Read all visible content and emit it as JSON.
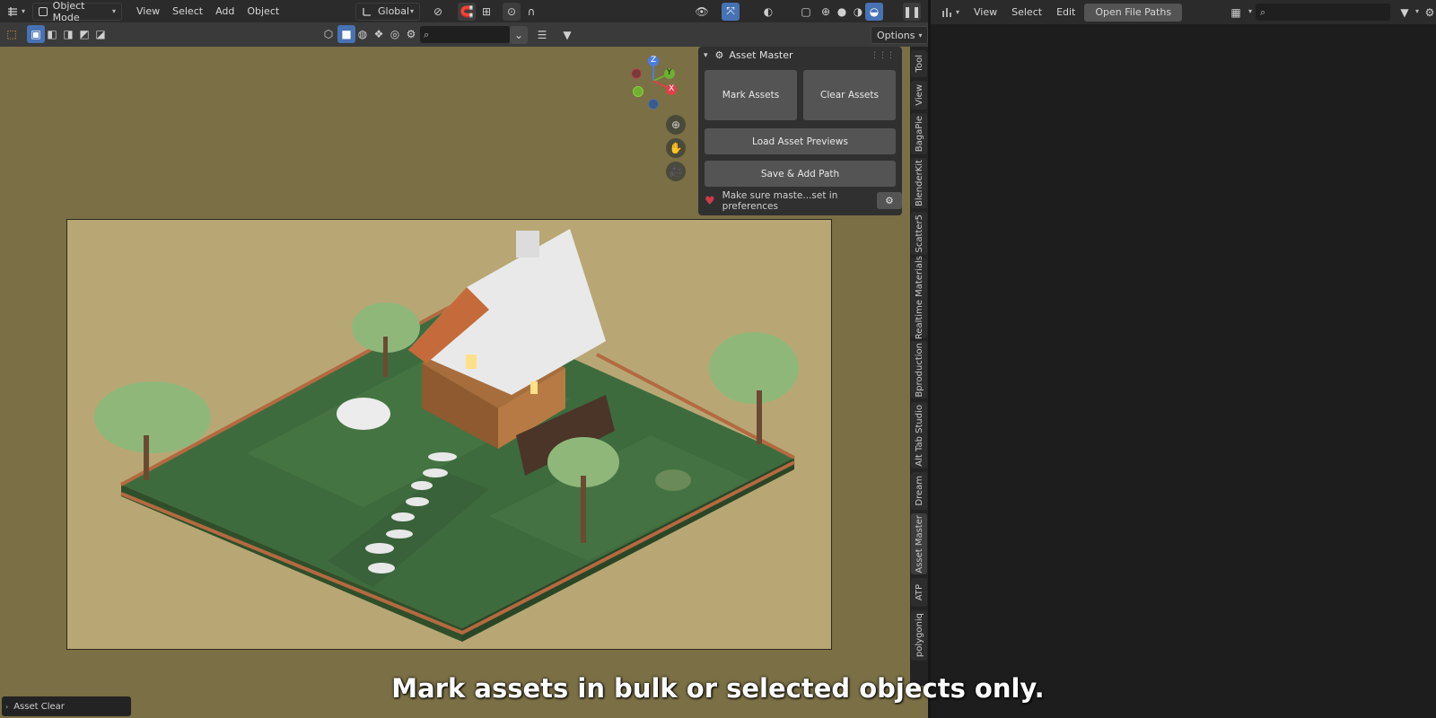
{
  "viewport_header": {
    "mode_label": "Object Mode",
    "menus": [
      "View",
      "Select",
      "Add",
      "Object"
    ],
    "transform_orientation": "Global"
  },
  "toolbar": {
    "options_label": "Options",
    "search_placeholder": ""
  },
  "asset_panel": {
    "title": "Asset Master",
    "mark_assets": "Mark Assets",
    "clear_assets": "Clear Assets",
    "load_previews": "Load Asset Previews",
    "save_add_path": "Save & Add Path",
    "hint": "Make sure maste...set in preferences"
  },
  "gizmo": {
    "z": "Z",
    "y": "Y",
    "x": "X"
  },
  "side_tabs": [
    "Tool",
    "View",
    "BagaPie",
    "BlenderKit",
    "Scatter5",
    "Realtime Materials",
    "Bproduction",
    "Alt Tab Studio",
    "Dream",
    "Asset Master",
    "ATP",
    "polygoniq"
  ],
  "active_tab": "Asset Master",
  "right_header": {
    "menus": [
      "View",
      "Select",
      "Edit"
    ],
    "open_file_paths": "Open File Paths",
    "search_placeholder": ""
  },
  "operator_panel": {
    "label": "Asset Clear"
  },
  "caption": "Mark assets in bulk or selected objects only.",
  "colors": {
    "viewport_bg": "#7a6f45",
    "accent": "#4772b3",
    "scene_bg": "#b8a774"
  }
}
